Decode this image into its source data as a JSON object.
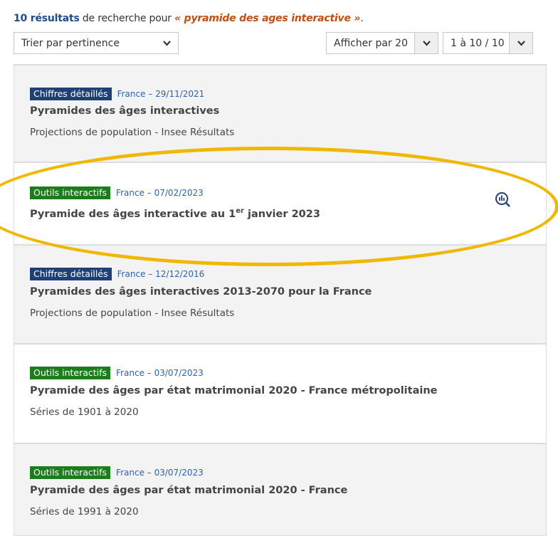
{
  "summary": {
    "count": "10 résultats",
    "middle": " de recherche pour ",
    "query": "« pyramide des ages interactive »",
    "end": "."
  },
  "sort_select": {
    "value": "Trier par pertinence"
  },
  "per_page_select": {
    "value": "Afficher par 20"
  },
  "range_select": {
    "value": "1 à 10 / 10"
  },
  "results": [
    {
      "badge": "Chiffres détaillés",
      "meta": "France – 29/11/2021",
      "title": "Pyramides des âges interactives",
      "subtitle": "Projections de population - Insee Résultats",
      "badge_color": "#1f3f77"
    },
    {
      "badge": "Outils interactifs",
      "meta": "France – 07/02/2023",
      "title_pre": "Pyramide des âges interactive au 1",
      "title_sup": "er",
      "title_post": " janvier 2023",
      "badge_color": "#1c7d1c",
      "icon": "data-search-icon"
    },
    {
      "badge": "Chiffres détaillés",
      "meta": "France – 12/12/2016",
      "title": "Pyramides des âges interactives 2013-2070 pour la France",
      "subtitle": "Projections de population - Insee Résultats",
      "badge_color": "#1f3f77"
    },
    {
      "badge": "Outils interactifs",
      "meta": "France – 03/07/2023",
      "title": "Pyramide des âges par état matrimonial 2020 - France métropolitaine",
      "subtitle": "Séries de 1901 à 2020",
      "badge_color": "#1c7d1c"
    },
    {
      "badge": "Outils interactifs",
      "meta": "France – 03/07/2023",
      "title": "Pyramide des âges par état matrimonial 2020 - France",
      "subtitle": "Séries de 1991 à 2020",
      "badge_color": "#1c7d1c"
    }
  ],
  "highlight_color": "#f0b800"
}
